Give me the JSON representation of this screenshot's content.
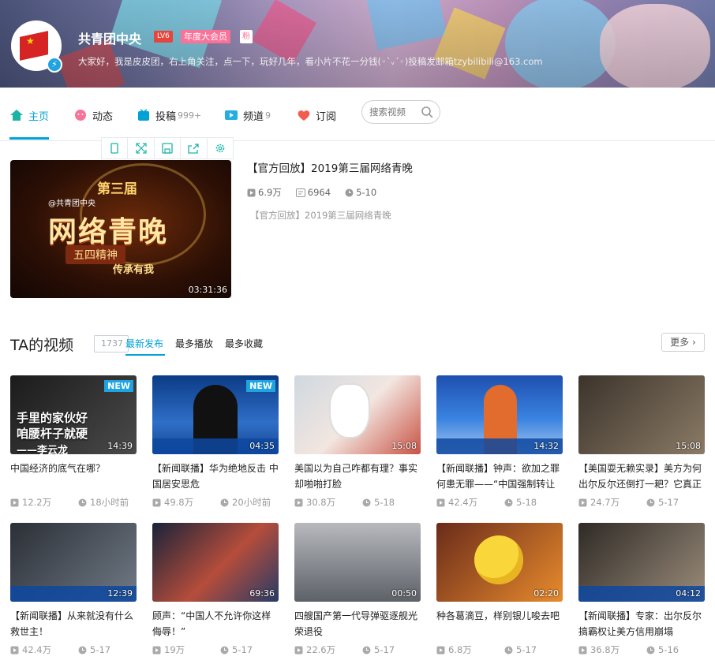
{
  "profile": {
    "name": "共青团中央",
    "level": "LV6",
    "vip_badge": "年度大会员",
    "fan_badge": "粉",
    "signature": "大家好，我是皮皮团，右上角关注，点一下，玩好几年，看小片不花一分钱(◦`ᵥ´◦)投稿发邮箱tzybilibili@163.com"
  },
  "nav": {
    "items": [
      {
        "label": "主页",
        "count": "",
        "icon": "home-icon",
        "color": "#1bb3a6"
      },
      {
        "label": "动态",
        "count": "",
        "icon": "dynamic-icon",
        "color": "#fb7299"
      },
      {
        "label": "投稿",
        "count": "999+",
        "icon": "upload-icon",
        "color": "#00a1d6"
      },
      {
        "label": "频道",
        "count": "9",
        "icon": "channel-icon",
        "color": "#23ade5"
      },
      {
        "label": "订阅",
        "count": "",
        "icon": "heart-icon",
        "color": "#f25d4e"
      }
    ],
    "search_placeholder": "搜索视频"
  },
  "featured": {
    "title": "【官方回放】2019第三届网络青晚",
    "views": "6.9万",
    "danmaku": "6964",
    "date": "5-10",
    "desc": "【官方回放】2019第三届网络青晚",
    "duration": "03:31:36",
    "thumb_text": {
      "edition": "第三届",
      "account": "@共青团中央",
      "main": "网络青晚",
      "motto": "五四精神",
      "slogan": "传承有我"
    }
  },
  "section": {
    "title": "TA的视频",
    "count": "1737",
    "tabs": [
      "最新发布",
      "最多播放",
      "最多收藏"
    ],
    "more": "更多"
  },
  "videos": [
    {
      "title": "中国经济的底气在哪？",
      "views": "12.2万",
      "time": "18小时前",
      "duration": "14:39",
      "badge": "NEW",
      "thumb_text": "手里的家伙好\n咱腰杆子就硬\n——李云龙"
    },
    {
      "title": "【新闻联播】华为绝地反击 中国居安思危",
      "views": "49.8万",
      "time": "20小时前",
      "duration": "04:35",
      "badge": "NEW",
      "thumb_text": ""
    },
    {
      "title": "美国以为自己咋都有理？事实却啪啪打脸",
      "views": "30.8万",
      "time": "5-18",
      "duration": "15:08",
      "badge": "",
      "thumb_text": ""
    },
    {
      "title": "【新闻联播】钟声：欲加之罪何患无罪——“中国强制转让",
      "views": "42.4万",
      "time": "5-18",
      "duration": "14:32",
      "badge": "",
      "thumb_text": ""
    },
    {
      "title": "【美国耍无赖实录】美方为何出尔反尔还倒打一耙？它真正",
      "views": "24.7万",
      "time": "5-17",
      "duration": "15:08",
      "badge": "",
      "thumb_text": ""
    },
    {
      "title": "【新闻联播】从来就没有什么救世主！",
      "views": "42.4万",
      "time": "5-17",
      "duration": "12:39",
      "badge": "",
      "thumb_text": ""
    },
    {
      "title": "顾声：“中国人不允许你这样侮辱！”",
      "views": "19万",
      "time": "5-17",
      "duration": "69:36",
      "badge": "",
      "thumb_text": ""
    },
    {
      "title": "四艘国产第一代导弹驱逐舰光荣退役",
      "views": "22.6万",
      "time": "5-17",
      "duration": "00:50",
      "badge": "",
      "thumb_text": ""
    },
    {
      "title": "种各葛滴豆，样别银儿唆去吧",
      "views": "6.8万",
      "time": "5-17",
      "duration": "02:20",
      "badge": "",
      "thumb_text": ""
    },
    {
      "title": "【新闻联播】专家：出尔反尔搞霸权让美方信用崩塌",
      "views": "36.8万",
      "time": "5-16",
      "duration": "04:12",
      "badge": "",
      "thumb_text": ""
    }
  ]
}
